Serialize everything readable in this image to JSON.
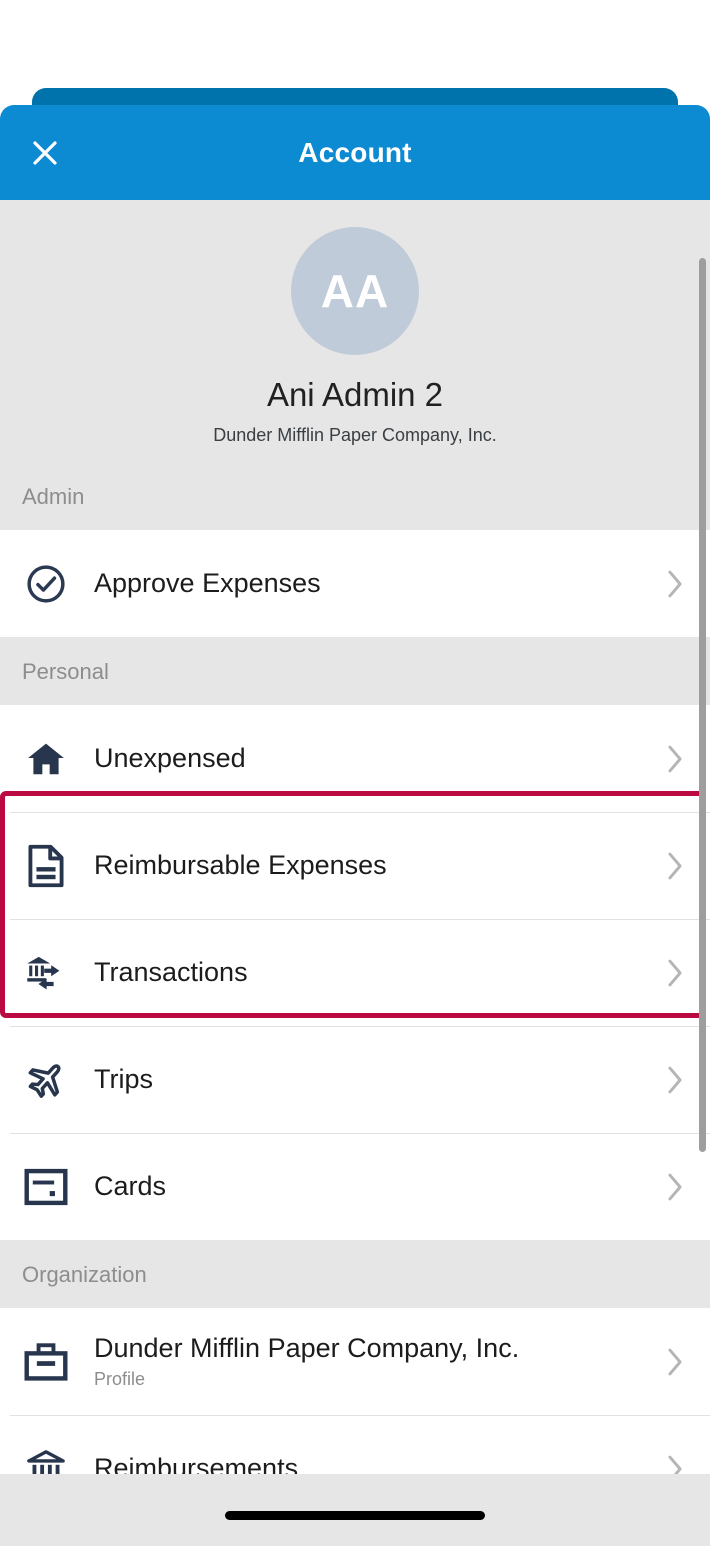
{
  "header": {
    "title": "Account",
    "close_icon": "close-icon",
    "background_color": "#0c8ad2",
    "behind_card_color": "#0073ac"
  },
  "profile": {
    "avatar_initials": "AA",
    "avatar_color": "#bfcbd8",
    "name": "Ani Admin 2",
    "organization": "Dunder Mifflin Paper Company, Inc."
  },
  "highlight": {
    "color": "#bb0a42"
  },
  "sections": [
    {
      "title": "Admin",
      "items": [
        {
          "label": "Approve Expenses",
          "sub": "",
          "icon": "check-circle-icon",
          "chevron": "chevron-right-icon"
        }
      ]
    },
    {
      "title": "Personal",
      "items": [
        {
          "label": "Unexpensed",
          "sub": "",
          "icon": "home-icon",
          "chevron": "chevron-right-icon"
        },
        {
          "label": "Reimbursable Expenses",
          "sub": "",
          "icon": "document-icon",
          "chevron": "chevron-right-icon"
        },
        {
          "label": "Transactions",
          "sub": "",
          "icon": "bank-transfer-icon",
          "chevron": "chevron-right-icon"
        },
        {
          "label": "Trips",
          "sub": "",
          "icon": "airplane-icon",
          "chevron": "chevron-right-icon"
        },
        {
          "label": "Cards",
          "sub": "",
          "icon": "credit-card-icon",
          "chevron": "chevron-right-icon"
        }
      ]
    },
    {
      "title": "Organization",
      "items": [
        {
          "label": "Dunder Mifflin Paper Company, Inc.",
          "sub": "Profile",
          "icon": "briefcase-icon",
          "chevron": "chevron-right-icon"
        },
        {
          "label": "Reimbursements",
          "sub": "",
          "icon": "bank-icon",
          "chevron": "chevron-right-icon"
        }
      ]
    }
  ]
}
